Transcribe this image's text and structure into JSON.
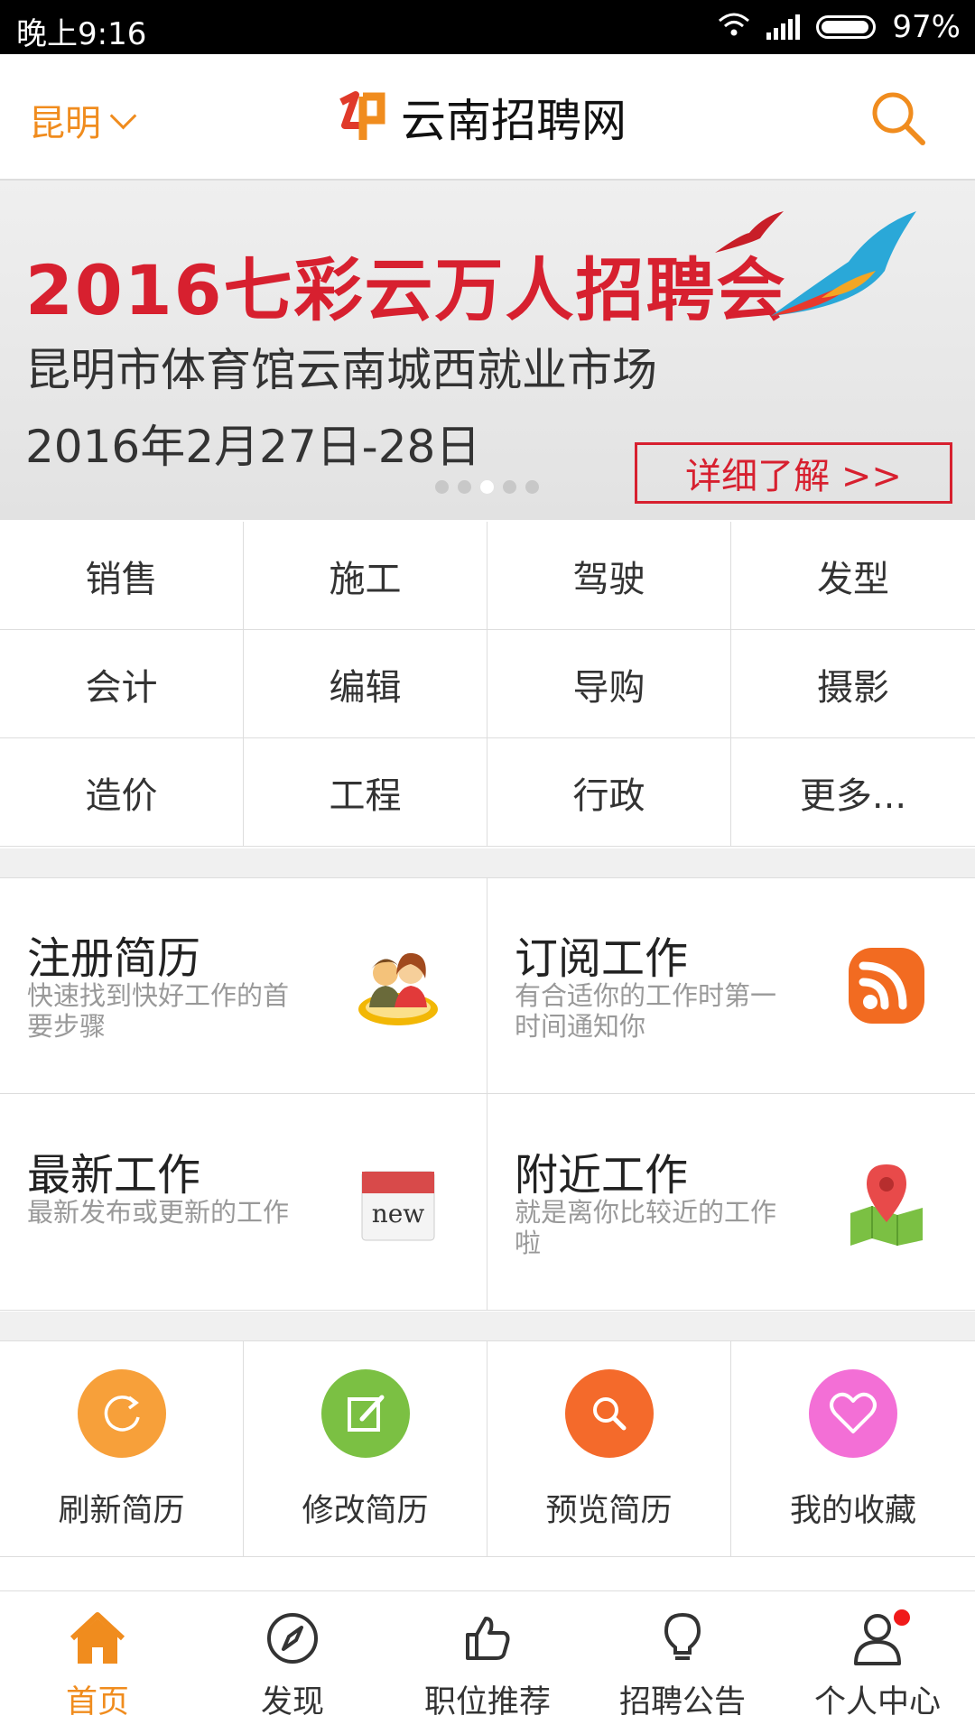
{
  "status": {
    "time": "晚上9:16",
    "battery": "97%"
  },
  "header": {
    "city": "昆明",
    "title": "云南招聘网"
  },
  "banner": {
    "title": "2016七彩云万人招聘会",
    "venue": "昆明市体育馆云南城西就业市场",
    "date": "2016年2月27日-28日",
    "button": "详细了解 >>"
  },
  "categories": [
    "销售",
    "施工",
    "驾驶",
    "发型",
    "会计",
    "编辑",
    "导购",
    "摄影",
    "造价",
    "工程",
    "行政",
    "更多..."
  ],
  "features": [
    {
      "title": "注册简历",
      "desc": "快速找到快好工作的首要步骤",
      "icon": "people-icon"
    },
    {
      "title": "订阅工作",
      "desc": "有合适你的工作时第一时间通知你",
      "icon": "rss-icon"
    },
    {
      "title": "最新工作",
      "desc": "最新发布或更新的工作",
      "icon": "new-icon",
      "icon_text": "new"
    },
    {
      "title": "附近工作",
      "desc": "就是离你比较近的工作啦",
      "icon": "map-pin-icon"
    }
  ],
  "actions": [
    {
      "label": "刷新简历",
      "icon": "refresh-icon",
      "color": "#f7a03a"
    },
    {
      "label": "修改简历",
      "icon": "edit-icon",
      "color": "#7bc043"
    },
    {
      "label": "预览简历",
      "icon": "search-icon",
      "color": "#f46a2b"
    },
    {
      "label": "我的收藏",
      "icon": "heart-icon",
      "color": "#f36fd6"
    }
  ],
  "tabs": [
    {
      "label": "首页",
      "icon": "home-icon"
    },
    {
      "label": "发现",
      "icon": "compass-icon"
    },
    {
      "label": "职位推荐",
      "icon": "thumbs-up-icon"
    },
    {
      "label": "招聘公告",
      "icon": "lightbulb-icon"
    },
    {
      "label": "个人中心",
      "icon": "user-icon"
    }
  ],
  "colors": {
    "accent": "#f08c1e",
    "banner_red": "#d7202f"
  }
}
